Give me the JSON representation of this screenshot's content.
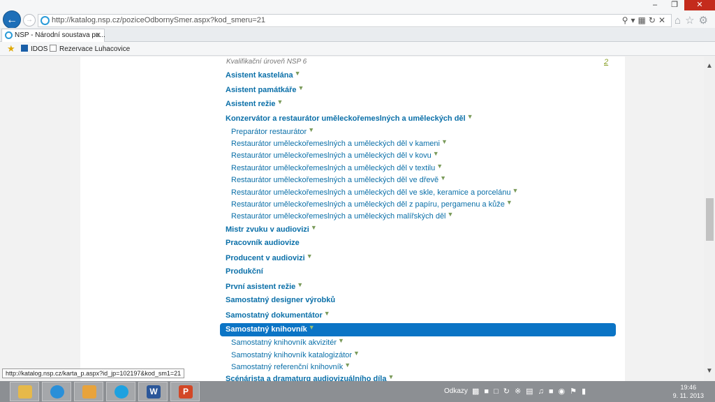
{
  "browser": {
    "url": "http://katalog.nsp.cz/pozice OdbornySmer.aspx?kod_smeru=21",
    "url_display": "http://katalog.nsp.cz/poziceOdbornySmer.aspx?kod_smeru=21",
    "tab_title": "NSP - Národní soustava po...",
    "favorites": [
      "IDOS",
      "Rezervace Luhacovice"
    ],
    "status_url": "http://katalog.nsp.cz/karta_p.aspx?id_jp=102197&kod_sm1=21"
  },
  "page": {
    "level_heading": "Kvalifikační úroveň NSP 6",
    "level_number": "2",
    "entries": [
      {
        "label": "Asistent kastelána",
        "type": "top",
        "flag": true
      },
      {
        "label": "Asistent památkáře",
        "type": "top",
        "flag": true
      },
      {
        "label": "Asistent režie",
        "type": "top",
        "flag": true
      },
      {
        "label": "Konzervátor a restaurátor uměleckořemeslných a uměleckých děl",
        "type": "top",
        "flag": true
      },
      {
        "label": "Preparátor restaurátor",
        "type": "sub",
        "flag": true
      },
      {
        "label": "Restaurátor uměleckořemeslných a uměleckých děl v kameni",
        "type": "sub",
        "flag": true
      },
      {
        "label": "Restaurátor uměleckořemeslných a uměleckých děl v kovu",
        "type": "sub",
        "flag": true
      },
      {
        "label": "Restaurátor uměleckořemeslných a uměleckých děl v textilu",
        "type": "sub",
        "flag": true
      },
      {
        "label": "Restaurátor uměleckořemeslných a uměleckých děl ve dřevě",
        "type": "sub",
        "flag": true
      },
      {
        "label": "Restaurátor uměleckořemeslných a uměleckých děl ve skle, keramice a porcelánu",
        "type": "sub",
        "flag": true
      },
      {
        "label": "Restaurátor uměleckořemeslných a uměleckých děl z papíru, pergamenu a kůže",
        "type": "sub",
        "flag": true
      },
      {
        "label": "Restaurátor uměleckořemeslných a uměleckých malířských děl",
        "type": "sub",
        "flag": true
      },
      {
        "label": "Mistr zvuku v audiovizi",
        "type": "top",
        "flag": true
      },
      {
        "label": "Pracovník audiovize",
        "type": "top",
        "flag": false
      },
      {
        "label": "Producent v audiovizi",
        "type": "top",
        "flag": true
      },
      {
        "label": "Produkční",
        "type": "top",
        "flag": false
      },
      {
        "label": "První asistent režie",
        "type": "top",
        "flag": true
      },
      {
        "label": "Samostatný designer výrobků",
        "type": "top",
        "flag": false
      },
      {
        "label": "Samostatný dokumentátor",
        "type": "top",
        "flag": true
      },
      {
        "label": "Samostatný knihovník",
        "type": "top",
        "flag": true,
        "highlighted": true
      },
      {
        "label": "Samostatný knihovník akvizitér",
        "type": "sub",
        "flag": true
      },
      {
        "label": "Samostatný knihovník katalogizátor",
        "type": "sub",
        "flag": true
      },
      {
        "label": "Samostatný referenční knihovník",
        "type": "sub",
        "flag": true
      },
      {
        "label": "Scénárista a dramaturg audiovizuálního díla",
        "type": "top",
        "flag": true
      }
    ]
  },
  "taskbar": {
    "tray_label": "Odkazy",
    "time": "19:46",
    "date": "9. 11. 2013",
    "apps": [
      "W",
      "P"
    ]
  },
  "colors": {
    "link": "#0a6fa8",
    "highlight": "#0b74c5",
    "flag": "#7a9a5a"
  }
}
